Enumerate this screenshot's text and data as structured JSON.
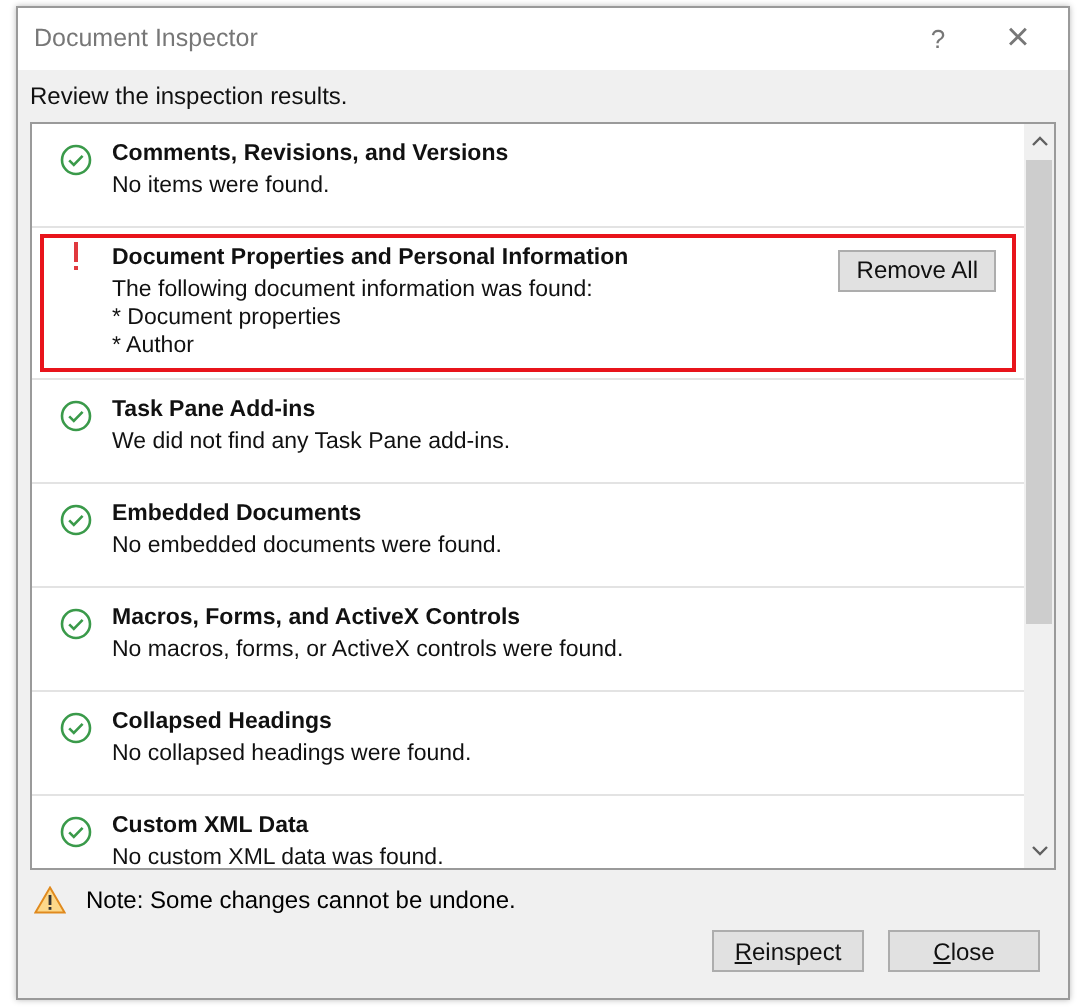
{
  "window": {
    "title": "Document Inspector",
    "help": "?",
    "close": "×"
  },
  "instruction": "Review the inspection results.",
  "results": [
    {
      "kind": "ok",
      "highlighted": false,
      "title": "Comments, Revisions, and Versions",
      "lines": [
        "No items were found."
      ]
    },
    {
      "kind": "found",
      "highlighted": true,
      "title": "Document Properties and Personal Information",
      "lines": [
        "The following document information was found:",
        "* Document properties",
        "* Author"
      ],
      "action": "Remove All"
    },
    {
      "kind": "ok",
      "highlighted": false,
      "title": "Task Pane Add-ins",
      "lines": [
        "We did not find any Task Pane add-ins."
      ]
    },
    {
      "kind": "ok",
      "highlighted": false,
      "title": "Embedded Documents",
      "lines": [
        "No embedded documents were found."
      ]
    },
    {
      "kind": "ok",
      "highlighted": false,
      "title": "Macros, Forms, and ActiveX Controls",
      "lines": [
        "No macros, forms, or ActiveX controls were found."
      ]
    },
    {
      "kind": "ok",
      "highlighted": false,
      "title": "Collapsed Headings",
      "lines": [
        "No collapsed headings were found."
      ]
    },
    {
      "kind": "ok",
      "highlighted": false,
      "title": "Custom XML Data",
      "lines": [
        "No custom XML data was found."
      ]
    }
  ],
  "note": "Note: Some changes cannot be undone.",
  "buttons": [
    "Reinspect",
    "Close"
  ]
}
